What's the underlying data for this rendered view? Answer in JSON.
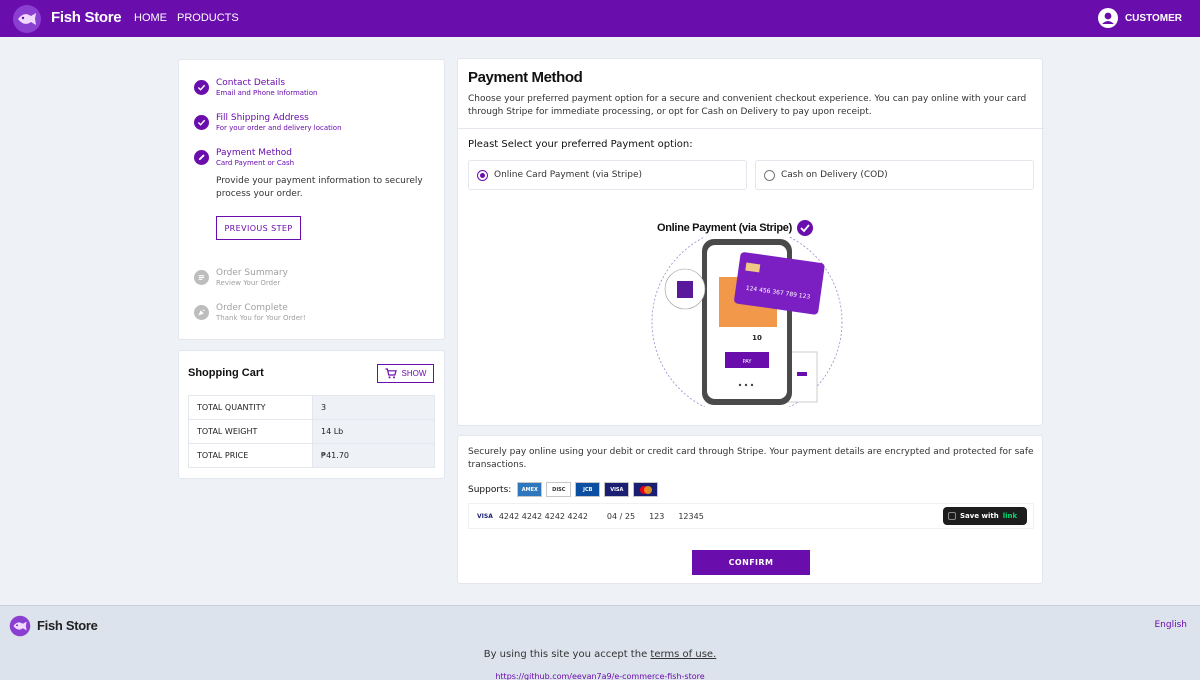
{
  "header": {
    "brand": "Fish Store",
    "nav": [
      "HOME",
      "PRODUCTS"
    ],
    "user_label": "CUSTOMER"
  },
  "steps": [
    {
      "title": "Contact Details",
      "subtitle": "Email and Phone Information",
      "state": "done"
    },
    {
      "title": "Fill Shipping Address",
      "subtitle": "For your order and delivery location",
      "state": "done"
    },
    {
      "title": "Payment Method",
      "subtitle": "Card Payment or Cash",
      "state": "active"
    },
    {
      "title": "Order Summary",
      "subtitle": "Review Your Order",
      "state": "todo"
    },
    {
      "title": "Order Complete",
      "subtitle": "Thank You for Your Order!",
      "state": "todo"
    }
  ],
  "active_step": {
    "description": "Provide your payment information to securely process your order.",
    "previous_label": "PREVIOUS STEP"
  },
  "cart": {
    "title": "Shopping Cart",
    "show_label": "SHOW",
    "rows": [
      {
        "label": "TOTAL QUANTITY",
        "value": "3"
      },
      {
        "label": "TOTAL WEIGHT",
        "value": "14 Lb"
      },
      {
        "label": "TOTAL PRICE",
        "value": "₱41.70"
      }
    ]
  },
  "payment": {
    "title": "Payment Method",
    "description": "Choose your preferred payment option for a secure and convenient checkout experience. You can pay online with your card through Stripe for immediate processing, or opt for Cash on Delivery to pay upon receipt.",
    "select_label": "Pleast Select your preferred Payment option:",
    "options": [
      {
        "label": "Online Card Payment (via Stripe)",
        "selected": true
      },
      {
        "label": "Cash on Delivery (COD)",
        "selected": false
      }
    ],
    "illustration_title": "Online Payment (via Stripe)",
    "illustration_card_number": "124 456 367 789 123",
    "illustration_pay_label": "PAY",
    "illustration_amount": "10"
  },
  "stripe": {
    "description": "Securely pay online using your debit or credit card through Stripe. Your payment details are encrypted and protected for safe transactions.",
    "supports_label": "Supports:",
    "card_logos": [
      "AMEX",
      "DISCOVER",
      "JCB",
      "VISA",
      "MASTERCARD"
    ],
    "card_brand": "VISA",
    "card_number": "4242 4242 4242 4242",
    "expiry": "04 / 25",
    "cvc": "123",
    "zip": "12345",
    "link_prefix": "Save with",
    "link_word": "link",
    "confirm_label": "CONFIRM"
  },
  "footer": {
    "brand": "Fish Store",
    "language": "English",
    "terms_prefix": "By using this site you accept the",
    "terms_link": "terms of use.",
    "repo_link": "https://github.com/eevan7a9/e-commerce-fish-store"
  },
  "colors": {
    "accent": "#6a0dad",
    "background": "#eef1f6",
    "muted": "#bdbdbd"
  }
}
